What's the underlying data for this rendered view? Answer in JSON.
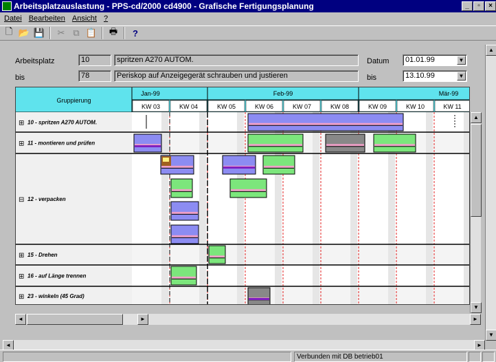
{
  "window": {
    "title": "Arbeitsplatzauslastung -   PPS-cd/2000    cd4900 - Grafische Fertigungsplanung"
  },
  "menu": {
    "items": [
      "Datei",
      "Bearbeiten",
      "Ansicht",
      "?"
    ]
  },
  "toolbar": {
    "icons": [
      "new-icon",
      "open-icon",
      "save-icon",
      "cut-icon",
      "copy-icon",
      "paste-icon",
      "print-icon",
      "help-icon"
    ]
  },
  "form": {
    "arbeitsplatz_label": "Arbeitsplatz",
    "arbeitsplatz_from": "10",
    "arbeitsplatz_from_desc": "spritzen A270 AUTOM.",
    "bis_label": "bis",
    "arbeitsplatz_to": "78",
    "arbeitsplatz_to_desc": "Periskop auf Anzeigegerät schrauben und justieren",
    "datum_label": "Datum",
    "datum_from": "01.01.99",
    "datum_bis_label": "bis",
    "datum_to": "13.10.99"
  },
  "gantt": {
    "group_header": "Gruppierung",
    "months": [
      "Jan-99",
      "Feb-99",
      "Mär-99"
    ],
    "weeks": [
      "KW 03",
      "KW 04",
      "KW 05",
      "KW 06",
      "KW 07",
      "KW 08",
      "KW 09",
      "KW 10",
      "KW 11"
    ],
    "rows": [
      {
        "expander": "⊞",
        "label": "10 - spritzen A270 AUTOM."
      },
      {
        "expander": "⊞",
        "label": "11 - montieren und prüfen"
      },
      {
        "expander": "⊟",
        "label": "12 - verpacken"
      },
      {
        "expander": "⊞",
        "label": "15 - Drehen"
      },
      {
        "expander": "⊞",
        "label": "16 - auf Länge trennen"
      },
      {
        "expander": "⊞",
        "label": "23 - winkeln (45 Grad)"
      }
    ],
    "colors": {
      "header": "#5fe3ed",
      "blue": "#8c8cf2",
      "green": "#7ce67c",
      "gray": "#888888",
      "pink": "#f0a0c8",
      "purple": "#8020c0",
      "gridline": "#e02020"
    }
  },
  "status": {
    "connection": "Verbunden mit DB betrieb01"
  }
}
